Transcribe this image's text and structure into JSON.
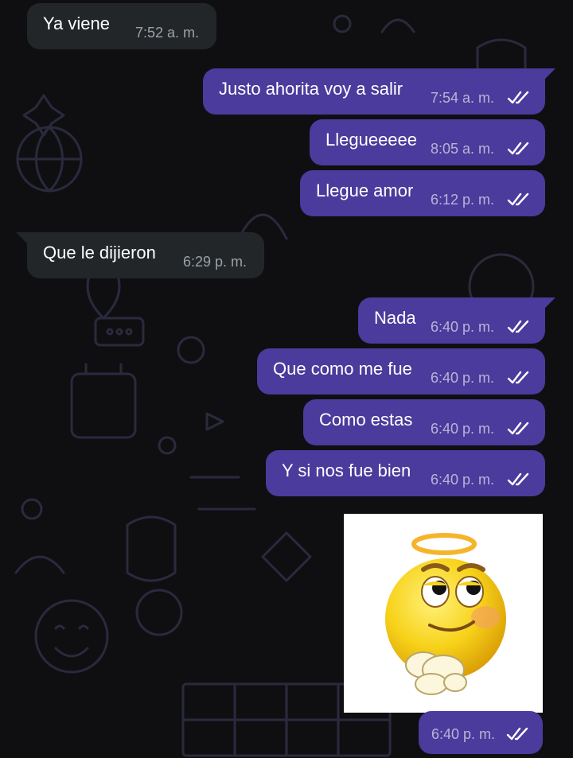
{
  "messages": [
    {
      "text": "Ya viene",
      "time": "7:52 a. m."
    },
    {
      "text": "Justo ahorita voy a salir",
      "time": "7:54 a. m."
    },
    {
      "text": "Llegueeeee",
      "time": "8:05 a. m."
    },
    {
      "text": "Llegue amor",
      "time": "6:12 p. m."
    },
    {
      "text": "Que le dijieron",
      "time": "6:29 p. m."
    },
    {
      "text": "Nada",
      "time": "6:40 p. m."
    },
    {
      "text": "Que como me fue",
      "time": "6:40 p. m."
    },
    {
      "text": "Como estas",
      "time": "6:40 p. m."
    },
    {
      "text": "Y si nos fue bien",
      "time": "6:40 p. m."
    }
  ],
  "sticker_message": {
    "time": "6:40 p. m.",
    "sticker": "angel-smiley-sticker"
  },
  "icons": {
    "read_receipt": "double-check-icon"
  },
  "colors": {
    "background": "#0f0f12",
    "incoming_bubble": "#232628",
    "outgoing_bubble": "#4a3b9c",
    "sticker_bg": "#ffffff"
  }
}
